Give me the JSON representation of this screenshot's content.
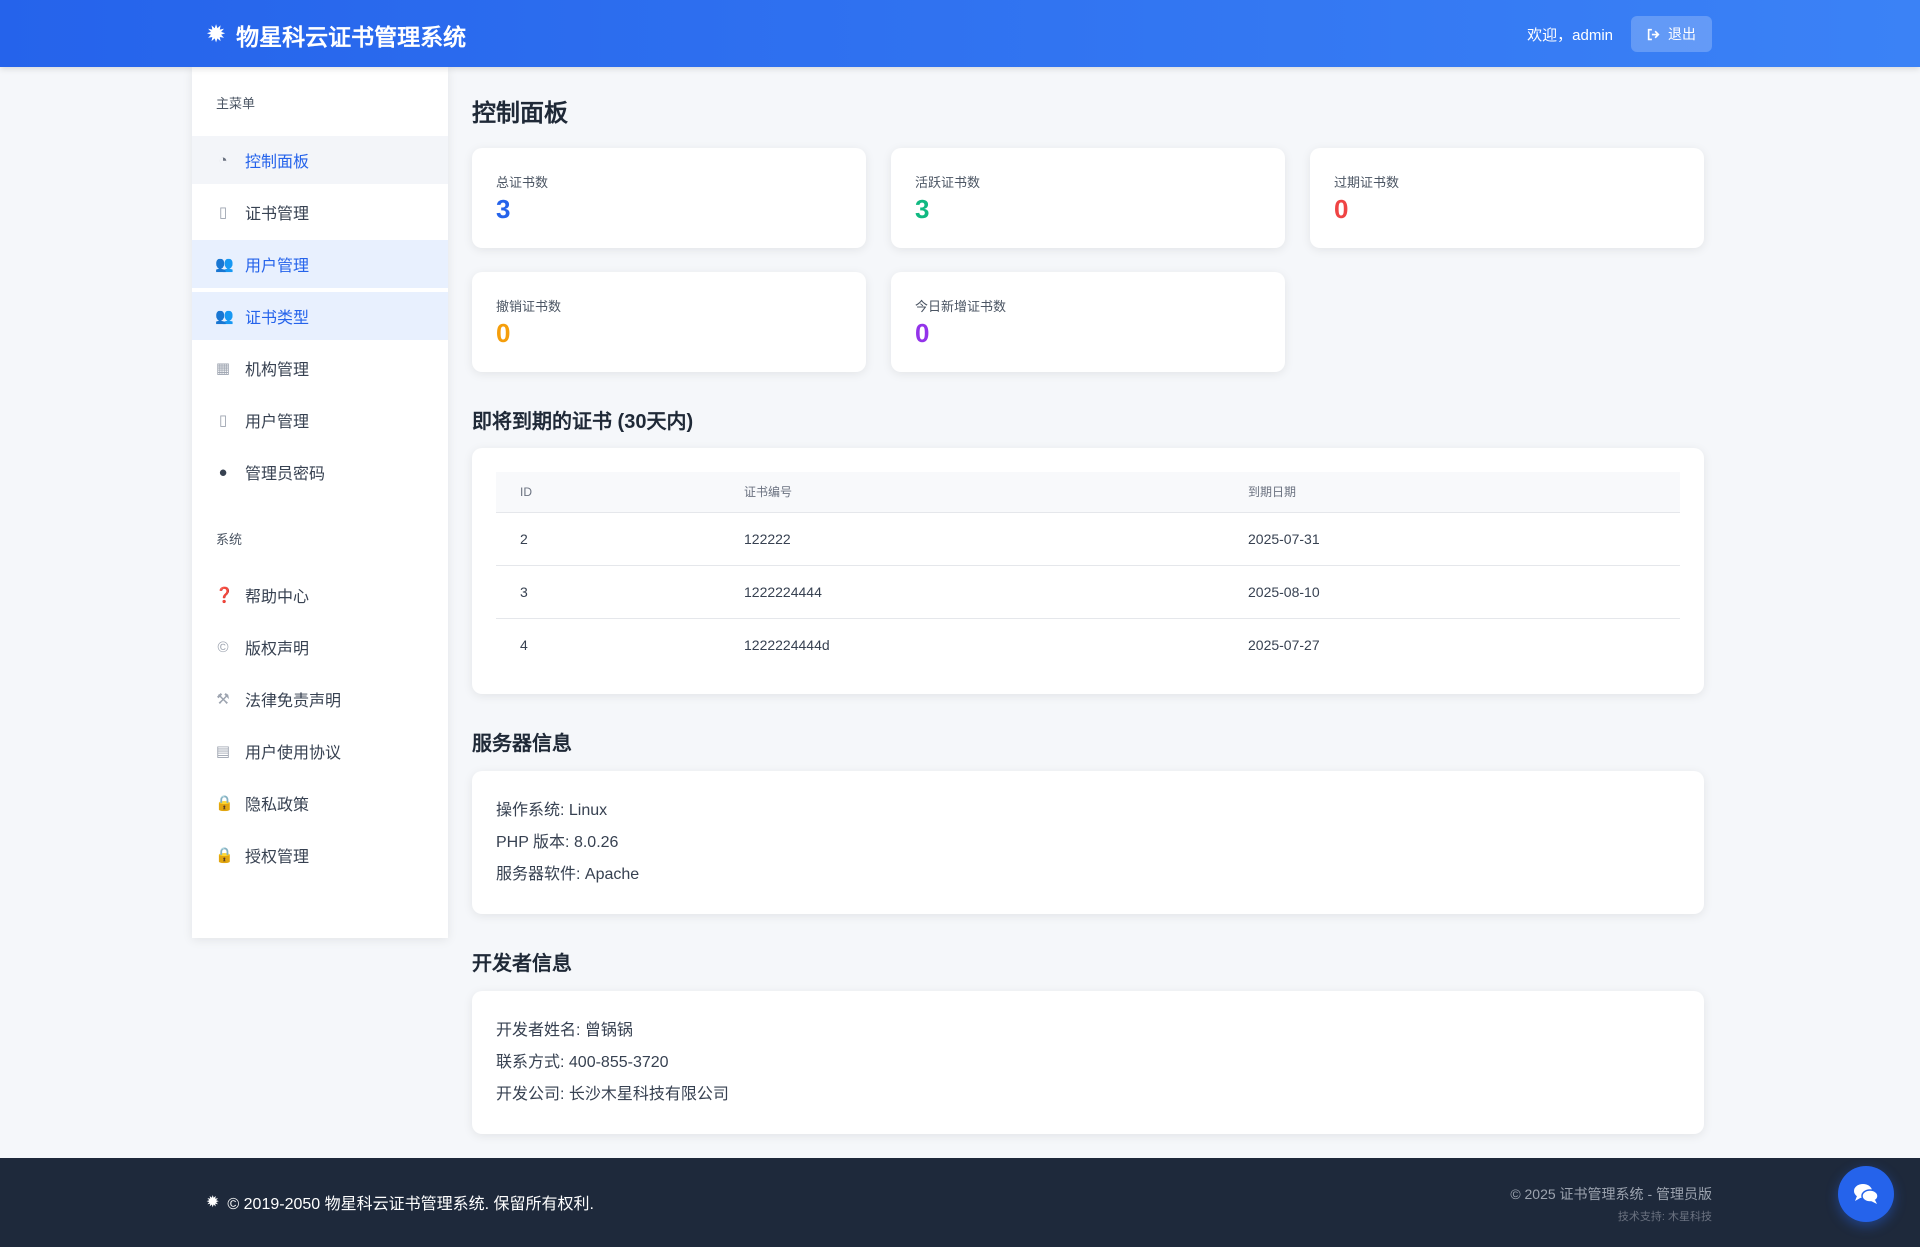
{
  "header": {
    "brand_icon": "gear-icon",
    "brand": "物星科云证书管理系统",
    "welcome": "欢迎，admin",
    "logout_label": "退出"
  },
  "sidebar": {
    "main_title": "主菜单",
    "main_items": [
      {
        "label": "控制面板",
        "icon": "dashboard-icon"
      },
      {
        "label": "证书管理",
        "icon": "document-icon"
      },
      {
        "label": "用户管理",
        "icon": "users-icon"
      },
      {
        "label": "证书类型",
        "icon": "users-icon"
      },
      {
        "label": "机构管理",
        "icon": "building-icon"
      },
      {
        "label": "用户管理",
        "icon": "document-icon"
      },
      {
        "label": "管理员密码",
        "icon": "chat-icon"
      }
    ],
    "system_title": "系统",
    "system_items": [
      {
        "label": "帮助中心",
        "icon": "question-icon"
      },
      {
        "label": "版权声明",
        "icon": "copyright-icon"
      },
      {
        "label": "法律免责声明",
        "icon": "gavel-icon"
      },
      {
        "label": "用户使用协议",
        "icon": "file-icon"
      },
      {
        "label": "隐私政策",
        "icon": "lock-icon"
      },
      {
        "label": "授权管理",
        "icon": "lock-icon"
      }
    ]
  },
  "main": {
    "title": "控制面板",
    "stats": [
      {
        "label": "总证书数",
        "value": "3",
        "color": "#2563eb"
      },
      {
        "label": "活跃证书数",
        "value": "3",
        "color": "#10b981"
      },
      {
        "label": "过期证书数",
        "value": "0",
        "color": "#ef4444"
      },
      {
        "label": "撤销证书数",
        "value": "0",
        "color": "#f59e0b"
      },
      {
        "label": "今日新增证书数",
        "value": "0",
        "color": "#9333ea"
      }
    ],
    "expiring": {
      "title": "即将到期的证书 (30天内)",
      "columns": [
        "ID",
        "证书编号",
        "到期日期"
      ],
      "rows": [
        [
          "2",
          "122222",
          "2025-07-31"
        ],
        [
          "3",
          "1222224444",
          "2025-08-10"
        ],
        [
          "4",
          "1222224444d",
          "2025-07-27"
        ]
      ]
    },
    "server": {
      "title": "服务器信息",
      "lines": [
        "操作系统: Linux",
        "PHP 版本: 8.0.26",
        "服务器软件: Apache"
      ]
    },
    "developer": {
      "title": "开发者信息",
      "lines": [
        "开发者姓名: 曾锅锅",
        "联系方式: 400-855-3720",
        "开发公司: 长沙木星科技有限公司"
      ]
    }
  },
  "footer": {
    "copyright": "© 2019-2050 物星科云证书管理系统. 保留所有权利.",
    "right_copy": "© 2025 证书管理系统 - 管理员版",
    "right_sub": "技术支持: 木星科技"
  },
  "colors": {
    "accent": "#2563eb",
    "footer_bg": "#1e293b"
  }
}
